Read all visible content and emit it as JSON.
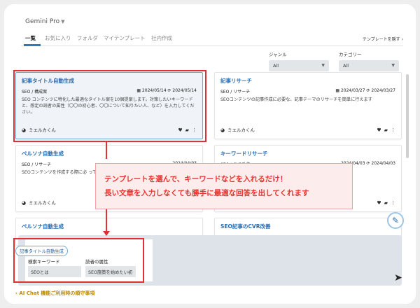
{
  "header": {
    "model": "Gemini Pro"
  },
  "tabs": [
    {
      "label": "一覧",
      "active": true
    },
    {
      "label": "お気に入り"
    },
    {
      "label": "フォルダ"
    },
    {
      "label": "マイテンプレート"
    },
    {
      "label": "社内作成"
    }
  ],
  "hide_templates": "テンプレートを隠す",
  "filters": {
    "genre": {
      "label": "ジャンル",
      "value": "All"
    },
    "category": {
      "label": "カテゴリー",
      "value": "All"
    }
  },
  "cards": [
    {
      "title": "記事タイトル自動生成",
      "category": "SEO / 構成案",
      "created": "2024/05/14",
      "updated": "2024/05/14",
      "desc": "SEO コンテンツに特化した最適なタイトル案を10個提案します。対策したいキーワードと、想定の読者の属性（〇〇の初心者、〇〇について知りたい人、など）を入力してください。",
      "author": "ミエルカくん"
    },
    {
      "title": "記事リサーチ",
      "category": "SEO / リサーチ",
      "created": "2024/03/27",
      "updated": "2024/03/27",
      "desc": "SEOコンテンツの記事作成に必要な、記事テーマのリサーチを簡単に行えます",
      "author": "ミエルカくん"
    },
    {
      "title": "ペルソナ自動生成",
      "category": "SEO / リサーチ",
      "created": "2024/04/03",
      "updated": "",
      "desc": "SEOコンテンツを作成する際に必 っているキーワードを入力してく",
      "author": "ミエルカくん"
    },
    {
      "title": "キーワードリサーチ",
      "category": "SEO / CVR改善",
      "created": "2024/04/03",
      "updated": "2024/04/03",
      "desc": "",
      "author": ""
    },
    {
      "title": "ペルソナ自動生成",
      "category": "",
      "created": "",
      "updated": "",
      "desc": "",
      "author": ""
    },
    {
      "title": "SEO記事のCVR改善",
      "category": "",
      "created": "",
      "updated": "",
      "desc": "",
      "author": ""
    }
  ],
  "callout": {
    "line1": "テンプレートを選んで、キーワードなどを入れるだけ！",
    "line2": "長い文章を入力しなくても勝手に最適な回答を出してくれます"
  },
  "input_panel": {
    "chip": "記事タイトル自動生成",
    "keyword_label": "検索キーワード",
    "keyword_value": "SEOとは",
    "attr_label": "読者の属性",
    "attr_value": "SEO施策を始めたい初"
  },
  "notice": "AI Chat 機能ご利用時の順守事項",
  "icons": [
    "caret-down-icon",
    "calendar-icon",
    "refresh-icon",
    "heart-icon",
    "folder-plus-icon",
    "more-icon",
    "avatar-icon",
    "pencil-icon",
    "send-icon",
    "chevron-right-icon"
  ],
  "colors": {
    "accent": "#2b7bb8",
    "annotation_red": "#e03131",
    "callout_bg": "#fdecec",
    "notice": "#c08a00"
  }
}
